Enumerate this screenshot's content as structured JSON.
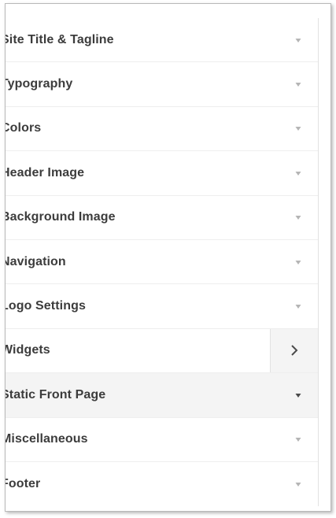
{
  "menu": {
    "items": [
      {
        "label": "Site Title & Tagline",
        "icon": "triangle-down-icon"
      },
      {
        "label": "Typography",
        "icon": "triangle-down-icon"
      },
      {
        "label": "Colors",
        "icon": "triangle-down-icon"
      },
      {
        "label": "Header Image",
        "icon": "triangle-down-icon"
      },
      {
        "label": "Background Image",
        "icon": "triangle-down-icon"
      },
      {
        "label": "Navigation",
        "icon": "triangle-down-icon"
      },
      {
        "label": "Logo Settings",
        "icon": "triangle-down-icon"
      },
      {
        "label": "Widgets",
        "icon": "chevron-right-icon"
      },
      {
        "label": "Static Front Page",
        "icon": "triangle-down-icon"
      },
      {
        "label": "Miscellaneous",
        "icon": "triangle-down-icon"
      },
      {
        "label": "Footer",
        "icon": "triangle-down-icon"
      }
    ]
  }
}
